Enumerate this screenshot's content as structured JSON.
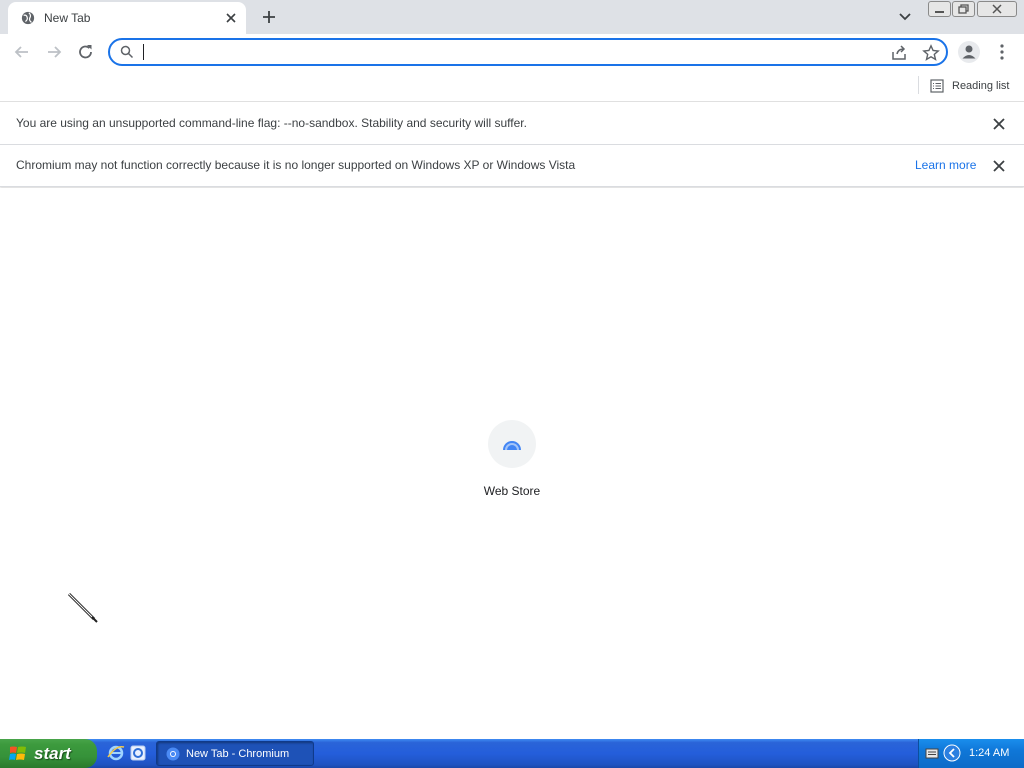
{
  "browser": {
    "tab": {
      "title": "New Tab"
    },
    "omnibox": {
      "value": "",
      "placeholder": ""
    },
    "bookmarks_bar": {
      "reading_list_label": "Reading list"
    }
  },
  "infobars": [
    {
      "text": "You are using an unsupported command-line flag: --no-sandbox. Stability and security will suffer.",
      "link": ""
    },
    {
      "text": "Chromium may not function correctly because it is no longer supported on Windows XP or Windows Vista",
      "link": "Learn more"
    }
  ],
  "ntp": {
    "shortcuts": [
      {
        "label": "Web Store",
        "icon": "web-store-icon"
      }
    ]
  },
  "taskbar": {
    "start_label": "start",
    "task_items": [
      {
        "label": "New Tab - Chromium",
        "icon": "chromium-icon"
      }
    ],
    "clock": "1:24 AM"
  },
  "colors": {
    "accent": "#1a73e8",
    "tabstrip": "#dee1e6",
    "taskbar": "#245edb",
    "start_button": "#3c9a3d"
  }
}
